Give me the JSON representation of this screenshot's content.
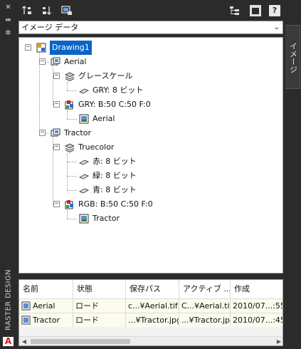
{
  "rail": {
    "title": "RASTER DESIGN",
    "logo": "A",
    "icons": [
      "close-icon",
      "auto-hide-icon",
      "settings-icon"
    ]
  },
  "toolbar": {
    "icons": [
      "sort-ascending-icon",
      "sort-descending-icon",
      "attach-image-icon",
      "tree-view-icon",
      "window-icon",
      "help-icon"
    ],
    "help_label": "?"
  },
  "dropdown": {
    "selected": "イメージ データ"
  },
  "tree": {
    "root": "Drawing1",
    "aerial": "Aerial",
    "aerial_group": "グレースケール",
    "aerial_band": "GRY: 8 ビット",
    "aerial_info": "GRY: B:50 C:50 F:0",
    "aerial_image": "Aerial",
    "tractor": "Tractor",
    "tractor_group": "Truecolor",
    "tractor_band_r": "赤: 8 ビット",
    "tractor_band_g": "緑: 8 ビット",
    "tractor_band_b": "青: 8 ビット",
    "tractor_info": "RGB: B:50 C:50 F:0",
    "tractor_image": "Tractor"
  },
  "table": {
    "columns": [
      "名前",
      "状態",
      "保存パス",
      "アクティブ ...",
      "作成"
    ],
    "rows": [
      [
        "Aerial",
        "ロード",
        "c...¥Aerial.tif",
        "C...¥Aerial.tif",
        "2010/07...:55"
      ],
      [
        "Tractor",
        "ロード",
        "...¥Tractor.jpg",
        "...¥Tractor.jpg",
        "2010/07...:45"
      ]
    ]
  },
  "side_tab": {
    "label": "イメージ"
  },
  "colors": {
    "selection": "#0a64c8",
    "panel_bg": "#2b2b2b",
    "row_bg": "#fbfbee"
  }
}
